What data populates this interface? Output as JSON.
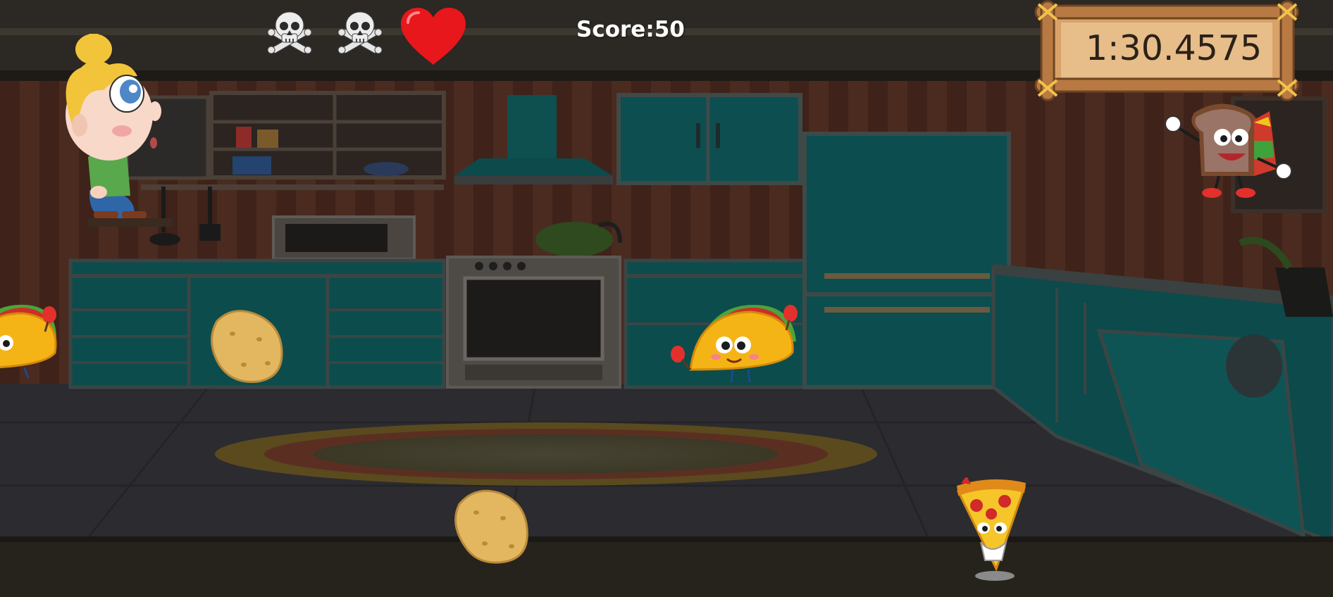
{
  "hud": {
    "lives": [
      {
        "icon": "skull-crossbones-icon",
        "state": "lost"
      },
      {
        "icon": "skull-crossbones-icon",
        "state": "lost"
      },
      {
        "icon": "heart-icon",
        "state": "remaining"
      }
    ],
    "score_text": "Score:50",
    "timer_text": "1:30.4575"
  },
  "characters": {
    "player": "blonde-boy-player",
    "sandwich": "sandwich-character",
    "tacos": [
      "taco-character",
      "taco-character"
    ],
    "potatoes": [
      "potato-item",
      "potato-item"
    ],
    "pizza": "pizza-slice-character"
  },
  "colors": {
    "heart": "#e8171c",
    "cabinet_teal": "#0e5c5e",
    "wall_brown": "#4a2a1e",
    "floor_dark": "#2a2a30",
    "ground_strip": "#26231d",
    "wood_sign": "#c98c4e",
    "taco_yellow": "#f5b416"
  }
}
